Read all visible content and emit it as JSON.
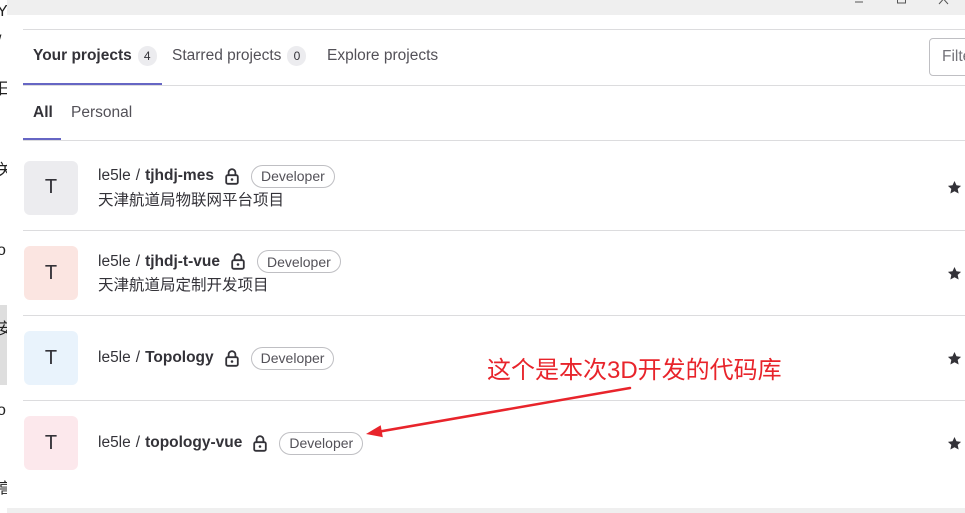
{
  "window_controls": {
    "minimize_icon": "minimize-icon",
    "maximize_icon": "maximize-icon",
    "close_icon": "close-icon"
  },
  "background_window": {
    "glyphs": [
      "Y",
      "/",
      "日",
      "关",
      "o",
      "安",
      "o",
      "高"
    ]
  },
  "nav": {
    "tabs": [
      {
        "label": "Your projects",
        "count": "4",
        "active": true
      },
      {
        "label": "Starred projects",
        "count": "0",
        "active": false
      },
      {
        "label": "Explore projects",
        "active": false
      }
    ],
    "filter": {
      "placeholder": "Filte"
    }
  },
  "subnav": {
    "tabs": [
      {
        "label": "All",
        "active": true
      },
      {
        "label": "Personal",
        "active": false
      }
    ]
  },
  "path_separator": "/",
  "projects": [
    {
      "avatar_letter": "T",
      "avatar_color": "#ececef",
      "namespace": "le5le",
      "name": "tjhdj-mes",
      "visibility_icon": "lock-icon",
      "role": "Developer",
      "description": "天津航道局物联网平台项目",
      "action_icon": "star-icon"
    },
    {
      "avatar_letter": "T",
      "avatar_color": "#fbe5e1",
      "namespace": "le5le",
      "name": "tjhdj-t-vue",
      "visibility_icon": "lock-icon",
      "role": "Developer",
      "description": "天津航道局定制开发项目",
      "action_icon": "star-icon"
    },
    {
      "avatar_letter": "T",
      "avatar_color": "#e9f3fc",
      "namespace": "le5le",
      "name": "Topology",
      "visibility_icon": "lock-icon",
      "role": "Developer",
      "action_icon": "star-icon"
    },
    {
      "avatar_letter": "T",
      "avatar_color": "#fce8ec",
      "namespace": "le5le",
      "name": "topology-vue",
      "visibility_icon": "lock-icon",
      "role": "Developer",
      "action_icon": "star-icon"
    }
  ],
  "annotation": {
    "text": "这个是本次3D开发的代码库"
  },
  "colors": {
    "accent": "#6666c4",
    "text": "#333238",
    "muted": "#535158",
    "border": "#dcdcde",
    "badge_border": "#bfbfc3",
    "annotation": "#e8242b"
  }
}
